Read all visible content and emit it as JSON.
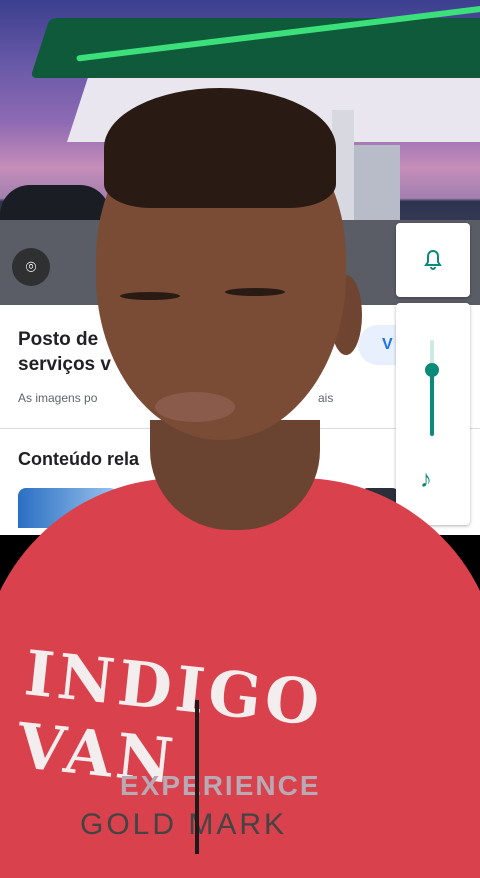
{
  "place_card": {
    "title_line1": "Posto de",
    "title_line2": "serviços v",
    "visit_button": "V",
    "disclaimer_start": "As imagens po",
    "disclaimer_end": "ais",
    "related_heading": "Conteúdo rela"
  },
  "icons": {
    "lens": "lens-icon",
    "bell": "bell-icon",
    "music": "music-note-icon"
  },
  "volume_panel": {
    "level": 0.69
  },
  "shirt": {
    "main_text": "INDIGO VAN",
    "line2": "EXPERIENCE",
    "line3": "GOLD MARK"
  },
  "colors": {
    "accent": "#0b8a7a",
    "link": "#1a73e8",
    "shirt": "#d9414c"
  }
}
